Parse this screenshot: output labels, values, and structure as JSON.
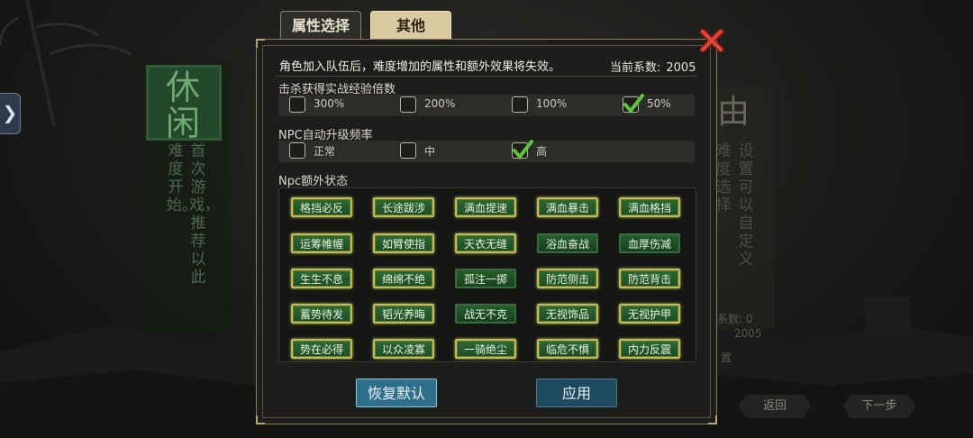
{
  "tabs": [
    {
      "label": "属性选择"
    },
    {
      "label": "其他"
    }
  ],
  "dialog": {
    "notice": "角色加入队伍后，难度增加的属性和额外效果将失效。",
    "coefficient_label": "当前系数:",
    "coefficient_value": "2005"
  },
  "sections": {
    "exp": {
      "label": "击杀获得实战经验倍数",
      "options": [
        {
          "label": "300%",
          "checked": false
        },
        {
          "label": "200%",
          "checked": false
        },
        {
          "label": "100%",
          "checked": false
        },
        {
          "label": "50%",
          "checked": true
        }
      ]
    },
    "npc_level": {
      "label": "NPC自动升级频率",
      "options": [
        {
          "label": "正常",
          "checked": false
        },
        {
          "label": "中",
          "checked": false
        },
        {
          "label": "高",
          "checked": true
        }
      ]
    },
    "npc_status": {
      "label": "Npc额外状态",
      "buttons": [
        {
          "label": "格挡必反",
          "active": true
        },
        {
          "label": "长途跋涉",
          "active": true
        },
        {
          "label": "满血提速",
          "active": true
        },
        {
          "label": "满血暴击",
          "active": true
        },
        {
          "label": "满血格挡",
          "active": true
        },
        {
          "label": "运筹帷幄",
          "active": true
        },
        {
          "label": "如臂使指",
          "active": true
        },
        {
          "label": "天衣无缝",
          "active": true
        },
        {
          "label": "浴血奋战",
          "active": false
        },
        {
          "label": "血厚伤减",
          "active": false
        },
        {
          "label": "生生不息",
          "active": true
        },
        {
          "label": "绵绵不绝",
          "active": true
        },
        {
          "label": "孤注一掷",
          "active": false
        },
        {
          "label": "防范侧击",
          "active": true
        },
        {
          "label": "防范背击",
          "active": true
        },
        {
          "label": "蓄势待发",
          "active": true
        },
        {
          "label": "韬光养晦",
          "active": true
        },
        {
          "label": "战无不克",
          "active": false
        },
        {
          "label": "无视饰品",
          "active": true
        },
        {
          "label": "无视护甲",
          "active": true
        },
        {
          "label": "势在必得",
          "active": true
        },
        {
          "label": "以众凌寡",
          "active": true
        },
        {
          "label": "一骑绝尘",
          "active": true
        },
        {
          "label": "临危不惧",
          "active": true
        },
        {
          "label": "内力反震",
          "active": true
        }
      ]
    }
  },
  "actions": {
    "reset": "恢复默认",
    "apply": "应用"
  },
  "background": {
    "left_seal": "休闲",
    "left_text_col1": "难度开始。",
    "left_text_col2": "首次游戏，推荐以此",
    "right_char": "由",
    "right_text_col1": "难度选择",
    "right_text_col2": "设置可以自定义",
    "right_coef_line1": "系数: 0",
    "right_coef_line2": "2005",
    "right_button": "置",
    "back": "返回",
    "next": "下一步"
  },
  "colors": {
    "status_active_border": "#c8b85c",
    "status_fill": "#245e2c",
    "check_green": "#5fc23a",
    "reset_button": "#2f6f8c",
    "apply_button": "#1f4a5e"
  }
}
